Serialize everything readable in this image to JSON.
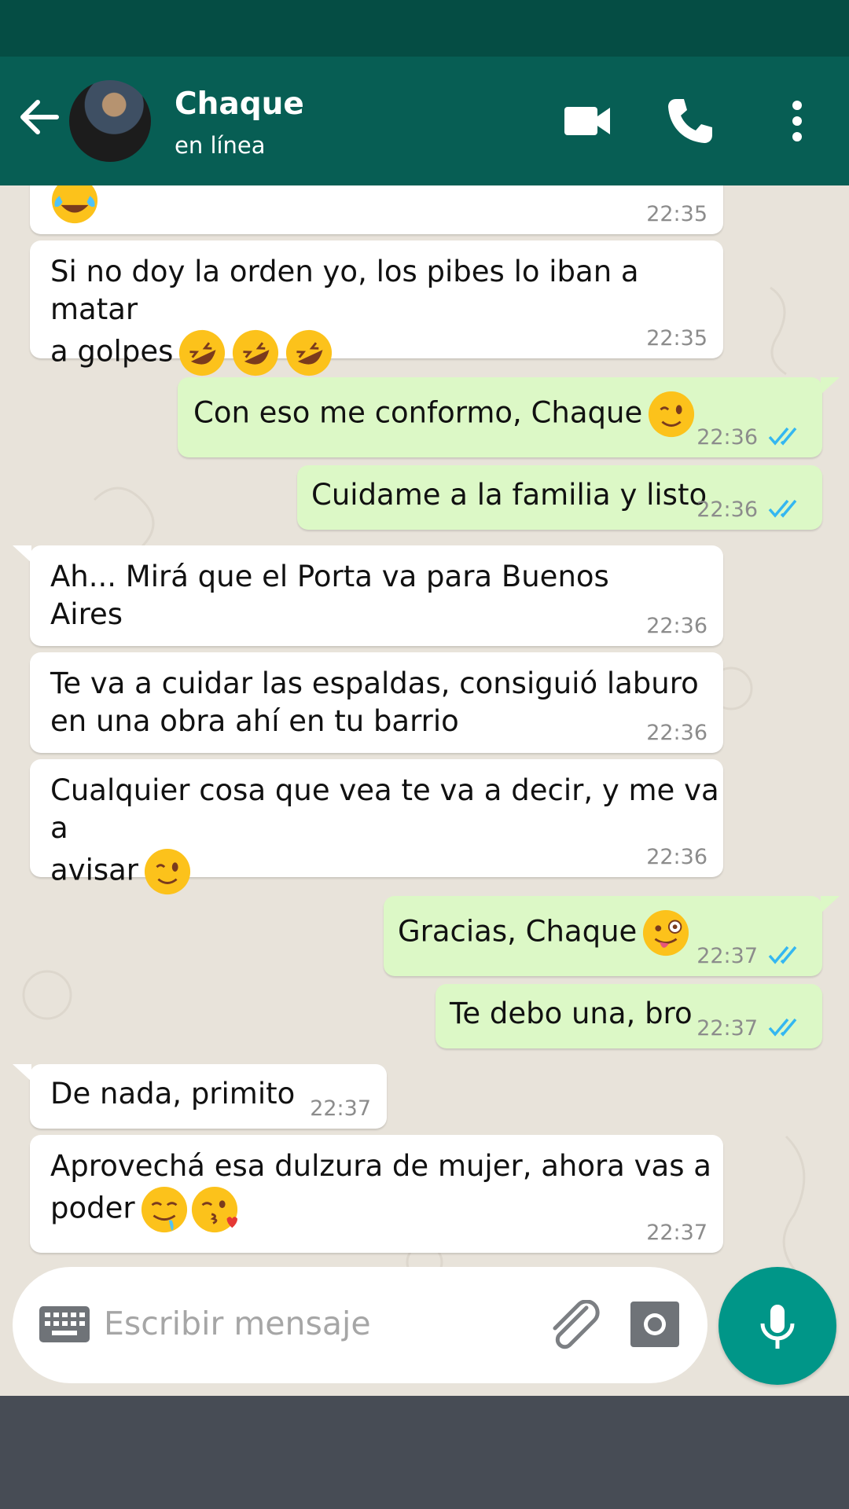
{
  "header": {
    "contact_name": "Chaque",
    "contact_status": "en línea"
  },
  "icons": {
    "back": "arrow-left-icon",
    "video_call": "video-camera-icon",
    "voice_call": "phone-icon",
    "menu": "more-vertical-icon",
    "keyboard": "keyboard-icon",
    "attach": "paperclip-icon",
    "camera": "camera-icon",
    "mic": "microphone-icon",
    "read_receipt": "double-check-icon"
  },
  "messages": [
    {
      "direction": "in",
      "text": "",
      "emoji": [
        "tears-of-joy"
      ],
      "time": "22:35"
    },
    {
      "direction": "in",
      "text": "Si no doy la orden yo, los pibes lo iban a matar\na golpes",
      "emoji": [
        "rofl",
        "rofl",
        "rofl"
      ],
      "time": "22:35"
    },
    {
      "direction": "out",
      "text": "Con eso me conformo, Chaque",
      "emoji": [
        "wink"
      ],
      "time": "22:36",
      "status": "read"
    },
    {
      "direction": "out",
      "text": "Cuidame a la familia y listo",
      "emoji": [],
      "time": "22:36",
      "status": "read"
    },
    {
      "direction": "in",
      "text": "Ah... Mirá que el Porta va para Buenos\nAires",
      "emoji": [],
      "time": "22:36"
    },
    {
      "direction": "in",
      "text": "Te va a cuidar las espaldas, consiguió laburo\nen una obra ahí en tu barrio",
      "emoji": [],
      "time": "22:36"
    },
    {
      "direction": "in",
      "text": "Cualquier cosa que vea te va a decir, y me va a\navisar",
      "emoji": [
        "wink"
      ],
      "time": "22:36"
    },
    {
      "direction": "out",
      "text": "Gracias, Chaque",
      "emoji": [
        "zany"
      ],
      "time": "22:37",
      "status": "read"
    },
    {
      "direction": "out",
      "text": "Te debo una, bro",
      "emoji": [],
      "time": "22:37",
      "status": "read"
    },
    {
      "direction": "in",
      "text": "De nada, primito",
      "emoji": [],
      "time": "22:37"
    },
    {
      "direction": "in",
      "text": "Aprovechá esa dulzura de mujer, ahora vas a\npoder",
      "emoji": [
        "drooling",
        "kiss"
      ],
      "time": "22:37"
    }
  ],
  "composer": {
    "placeholder": "Escribir mensaje"
  },
  "colors": {
    "status_bar": "#054d44",
    "app_bar": "#075e54",
    "outgoing_bubble": "#dcf8c6",
    "incoming_bubble": "#ffffff",
    "read_tick": "#34b7f1",
    "mic_button": "#009688",
    "nav_bar": "#474c55"
  }
}
